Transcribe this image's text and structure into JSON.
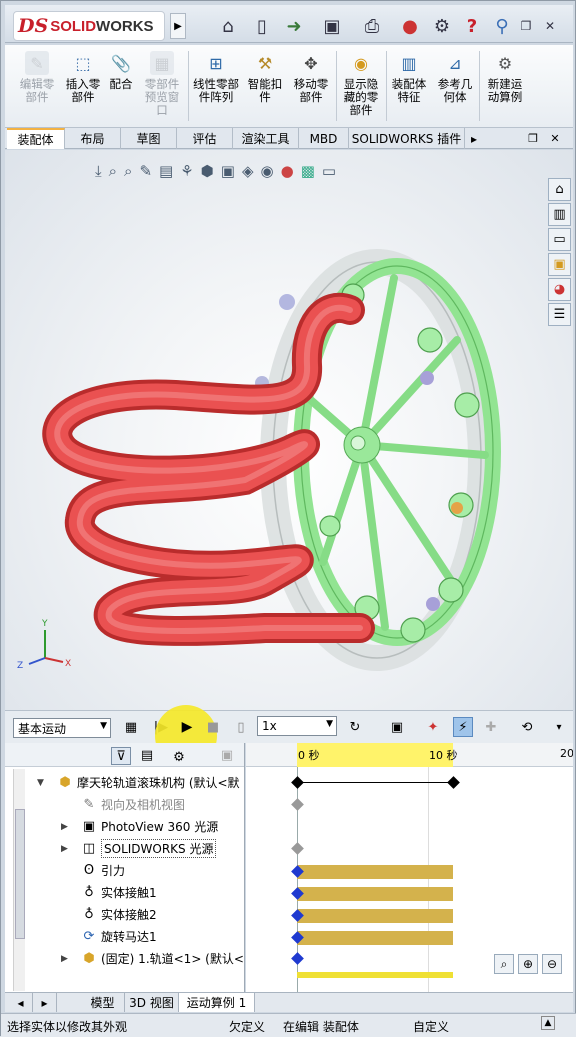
{
  "titlebar": {
    "brand_ds": "DS",
    "brand_name": "SOLID",
    "brand_name2": "WORKS",
    "flyout": "▶",
    "icons": [
      "home-icon",
      "new-document-icon",
      "open-file-icon",
      "save-icon",
      "print-icon",
      "rebuild-traffic-light-icon",
      "options-icon",
      "help-icon",
      "search-icon"
    ]
  },
  "ribbon": {
    "items": [
      {
        "label": "编辑零\n部件",
        "icon": "edit-component-icon",
        "disabled": true
      },
      {
        "label": "插入零\n部件",
        "icon": "insert-component-icon",
        "disabled": false
      },
      {
        "label": "配合",
        "icon": "mate-icon",
        "disabled": false
      },
      {
        "label": "零部件\n预览窗\n口",
        "icon": "component-preview-icon",
        "disabled": true
      },
      {
        "label": "线性零部\n件阵列",
        "icon": "linear-pattern-icon",
        "disabled": false
      },
      {
        "label": "智能扣\n件",
        "icon": "smart-fasteners-icon",
        "disabled": false
      },
      {
        "label": "移动零\n部件",
        "icon": "move-component-icon",
        "disabled": false
      },
      {
        "label": "显示隐\n藏的零\n部件",
        "icon": "show-hidden-icon",
        "disabled": false
      },
      {
        "label": "装配体\n特征",
        "icon": "assembly-features-icon",
        "disabled": false
      },
      {
        "label": "参考几\n何体",
        "icon": "reference-geometry-icon",
        "disabled": false
      },
      {
        "label": "新建运\n动算例",
        "icon": "new-motion-study-icon",
        "disabled": false
      }
    ]
  },
  "command_tabs": [
    "装配体",
    "布局",
    "草图",
    "评估",
    "渲染工具",
    "MBD",
    "SOLIDWORKS 插件"
  ],
  "motion": {
    "type": "基本运动",
    "speed": "1x"
  },
  "timeline": {
    "t0": "0 秒",
    "t10": "10 秒",
    "t20": "20"
  },
  "tree": {
    "root": "摩天轮轨道滚珠机构 (默认<默",
    "items": [
      {
        "label": "视向及相机视图",
        "icon": "camera-icon",
        "grey": true
      },
      {
        "label": "PhotoView 360 光源",
        "icon": "photoview-lights-icon",
        "grey": false
      },
      {
        "label": "SOLIDWORKS 光源",
        "icon": "lights-icon",
        "grey": false
      },
      {
        "label": "引力",
        "icon": "gravity-icon",
        "grey": false
      },
      {
        "label": "实体接触1",
        "icon": "contact-icon",
        "grey": false
      },
      {
        "label": "实体接触2",
        "icon": "contact-icon",
        "grey": false
      },
      {
        "label": "旋转马达1",
        "icon": "rotary-motor-icon",
        "grey": false
      },
      {
        "label": "(固定) 1.轨道<1> (默认<<",
        "icon": "part-icon",
        "grey": false
      }
    ]
  },
  "bottom_tabs": [
    "模型",
    "3D 视图",
    "运动算例 1"
  ],
  "status": {
    "left": "选择实体以修改其外观",
    "s1": "欠定义",
    "s2": "在编辑 装配体",
    "s3": "自定义"
  },
  "colors": {
    "spring": "#e44a4a",
    "wheel": "#8fe08f",
    "accent": "#f3b243",
    "timebar": "#d4b24c",
    "timeline_hi": "#fff36a"
  }
}
